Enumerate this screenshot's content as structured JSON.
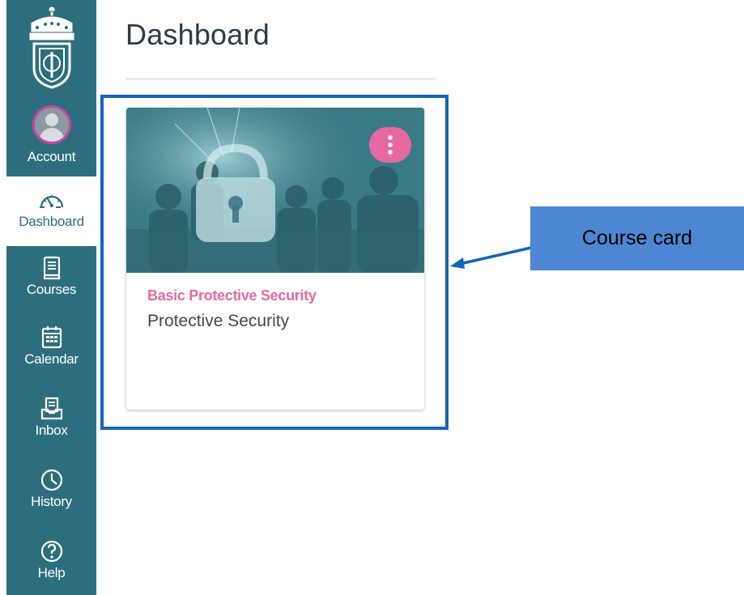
{
  "sidebar": {
    "items": [
      {
        "id": "account",
        "label": "Account",
        "icon": "avatar"
      },
      {
        "id": "dashboard",
        "label": "Dashboard",
        "icon": "speedometer-icon",
        "active": true
      },
      {
        "id": "courses",
        "label": "Courses",
        "icon": "book-icon"
      },
      {
        "id": "calendar",
        "label": "Calendar",
        "icon": "calendar-icon"
      },
      {
        "id": "inbox",
        "label": "Inbox",
        "icon": "inbox-icon"
      },
      {
        "id": "history",
        "label": "History",
        "icon": "clock-icon"
      },
      {
        "id": "help",
        "label": "Help",
        "icon": "question-icon"
      }
    ]
  },
  "main": {
    "title": "Dashboard"
  },
  "course_card": {
    "title": "Basic Protective Security",
    "subtitle": "Protective Security"
  },
  "callout": {
    "label": "Course card"
  },
  "colors": {
    "sidebar": "#2d6e7e",
    "accent_pink": "#e66aa1",
    "highlight_blue": "#1566b7",
    "callout_blue": "#4d86d2",
    "card_image": "#3b7d87"
  }
}
